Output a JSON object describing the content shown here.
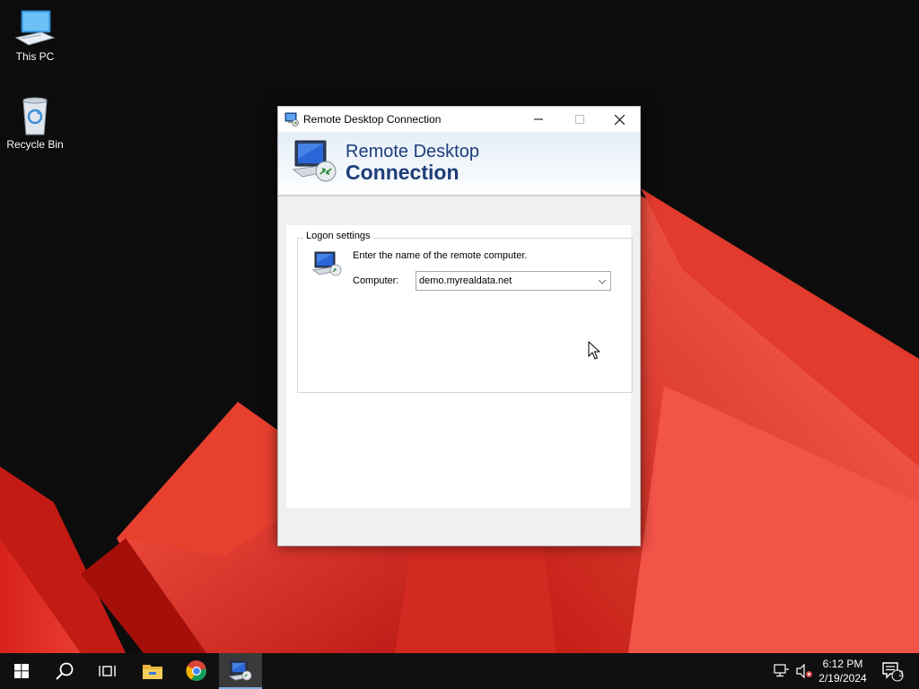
{
  "desktop": {
    "icons": [
      {
        "label": "This PC",
        "icon": "this-pc-icon"
      },
      {
        "label": "Recycle Bin",
        "icon": "recycle-bin-icon"
      }
    ]
  },
  "window": {
    "title": "Remote Desktop Connection",
    "banner_line1": "Remote Desktop",
    "banner_line2": "Connection",
    "group_label": "Logon settings",
    "hint": "Enter the name of the remote computer.",
    "computer_label": "Computer:",
    "computer_value": "demo.myrealdata.net",
    "controls": [
      "minimize",
      "maximize",
      "close"
    ]
  },
  "taskbar": {
    "items": [
      "start-icon",
      "search-icon",
      "task-view-icon",
      "file-explorer-icon",
      "chrome-icon",
      "remote-desktop-icon"
    ],
    "active_item": "remote-desktop-icon",
    "tray": [
      "network-icon",
      "volume-muted-icon"
    ],
    "time": "6:12 PM",
    "date": "2/19/2024",
    "notification_count": "3"
  },
  "colors": {
    "banner_text": "#1e3d7a",
    "wallpaper_red": "#e5352b",
    "wallpaper_dark": "#0c0c0c",
    "taskbar": "#101010",
    "active_indicator": "#7aaee0"
  }
}
